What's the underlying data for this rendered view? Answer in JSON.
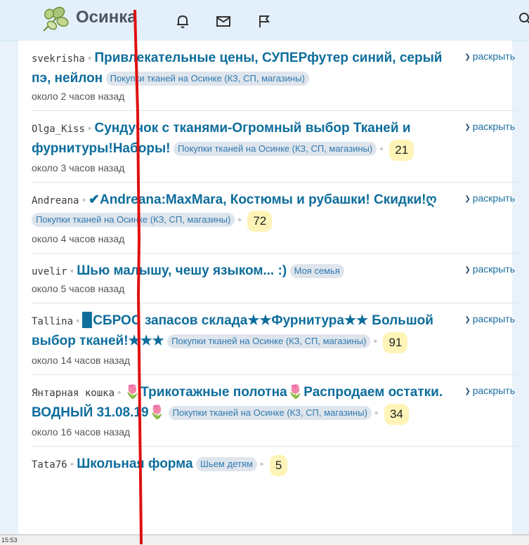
{
  "brand": {
    "name": "Осинка"
  },
  "list": {
    "items": [
      {
        "author": "svekrisha",
        "title": "Привлекательные цены, СУПЕРфутер синий, серый пэ, нейлон",
        "tag": "Покупки тканей на Осинке (КЗ, СП, магазины)",
        "count": null,
        "time": "около 2 часов назад",
        "expand": "раскрыть"
      },
      {
        "author": "Olga_Kiss",
        "title": "Сундучок с тканями-Огромный выбор Тканей и фурнитуры!Наборы!",
        "tag": "Покупки тканей на Осинке (КЗ, СП, магазины)",
        "count": "21",
        "time": "около 3 часов назад",
        "expand": "раскрыть"
      },
      {
        "author": "Andreana",
        "title": "✔Andreana:MaxMara, Костюмы и рубашки! Скидки!ღ",
        "tag": "Покупки тканей на Осинке (КЗ, СП, магазины)",
        "count": "72",
        "time": "около 4 часов назад",
        "expand": "раскрыть"
      },
      {
        "author": "uvelir",
        "title": "Шью малышу, чешу языком... :)",
        "tag": "Моя семья",
        "count": null,
        "time": "около 5 часов назад",
        "expand": "раскрыть"
      },
      {
        "author": "Tallina",
        "title": "▉СБРОС запасов склада★★Фурнитура★★ Большой выбор тканей!★★★",
        "tag": "Покупки тканей на Осинке (КЗ, СП, магазины)",
        "count": "91",
        "time": "около 14 часов назад",
        "expand": "раскрыть"
      },
      {
        "author": "Янтарная кошка",
        "title": "🌷Трикотажные полотна🌷Распродаем остатки. ВОДНЫЙ 31.08.19🌷",
        "tag": "Покупки тканей на Осинке (КЗ, СП, магазины)",
        "count": "34",
        "time": "около 16 часов назад",
        "expand": "раскрыть"
      },
      {
        "author": "Tata76",
        "title": "Школьная форма",
        "tag": "Шьем детям",
        "count": "5",
        "time": "",
        "expand": ""
      }
    ]
  },
  "statusbar": {
    "text": "15:53"
  },
  "colors": {
    "accent": "#0d6d9c",
    "tag_bg": "#dfe5ec",
    "count_bg": "#fff4b8",
    "overlay_line": "#e01010"
  },
  "icons": [
    "logo-leaf-icon",
    "bell-icon",
    "mail-icon",
    "flag-icon",
    "search-icon",
    "chevron-down-icon"
  ]
}
